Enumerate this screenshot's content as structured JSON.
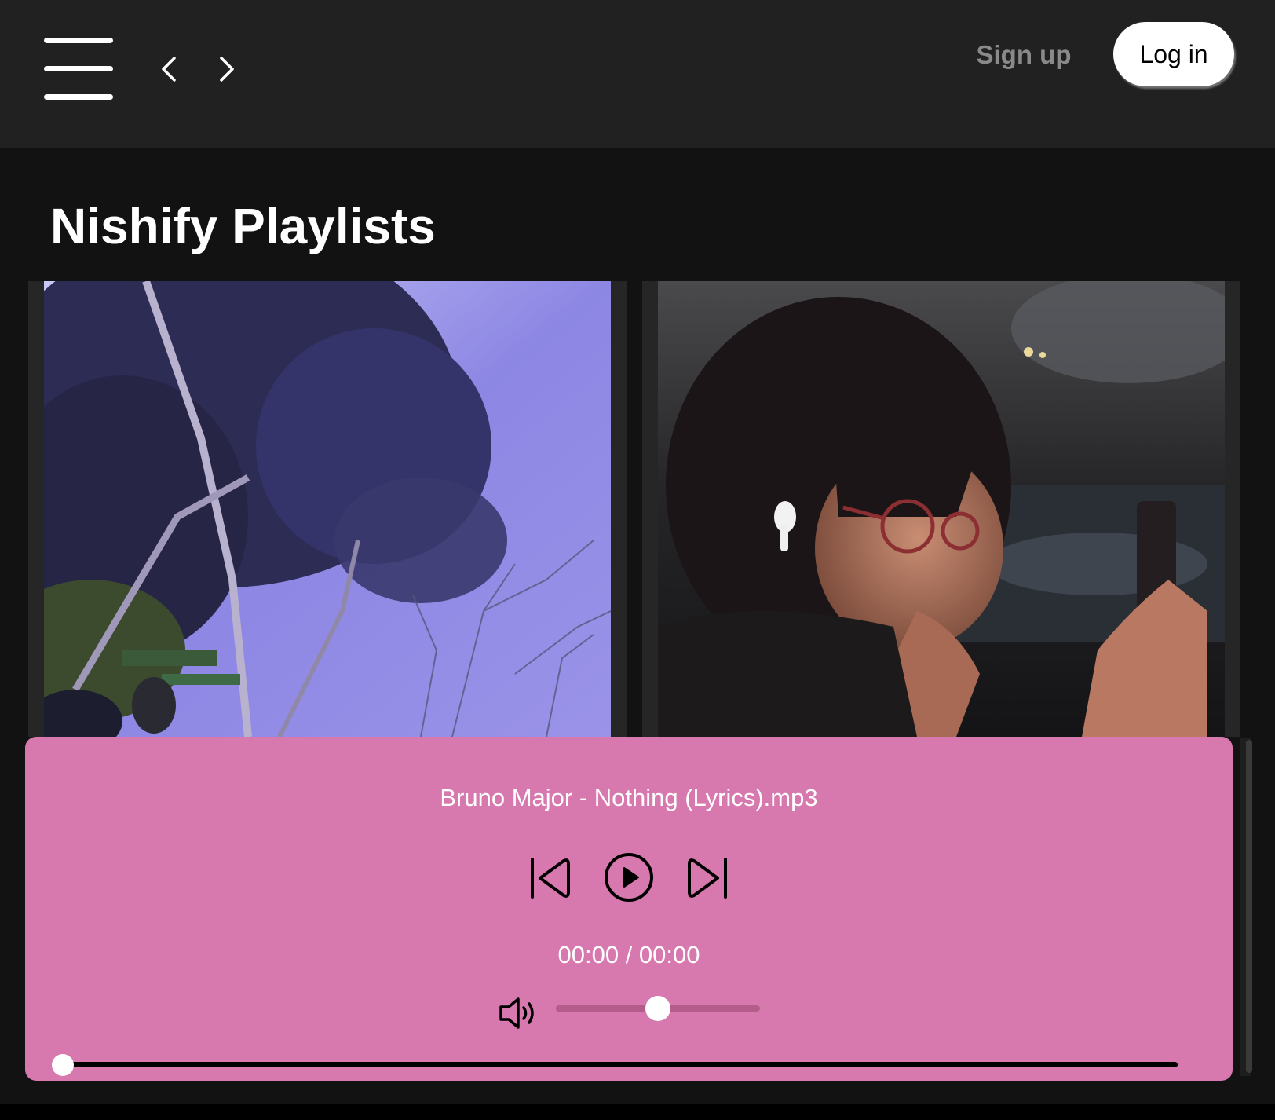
{
  "page": {
    "title": "Nishify Playlists"
  },
  "header": {
    "menu_icon": "hamburger-menu-icon",
    "back_icon": "chevron-left-icon",
    "forward_icon": "chevron-right-icon",
    "signup_label": "Sign up",
    "login_label": "Log in"
  },
  "playlists": [
    {
      "image": "trees-and-sky-photo"
    },
    {
      "image": "girl-with-earbuds-photo"
    }
  ],
  "player": {
    "song_title": "Bruno Major - Nothing (Lyrics).mp3",
    "time_display": "00:00 / 00:00",
    "previous_icon": "skip-previous-icon",
    "play_icon": "play-circle-icon",
    "next_icon": "skip-next-icon",
    "volume_icon": "speaker-icon",
    "volume_level": 0.5,
    "progress": 0.0
  },
  "colors": {
    "topbar": "#212121",
    "background": "#121212",
    "player_background": "#d779ae",
    "login_button": "#ffffff",
    "signup_text": "#8a8a8a"
  }
}
